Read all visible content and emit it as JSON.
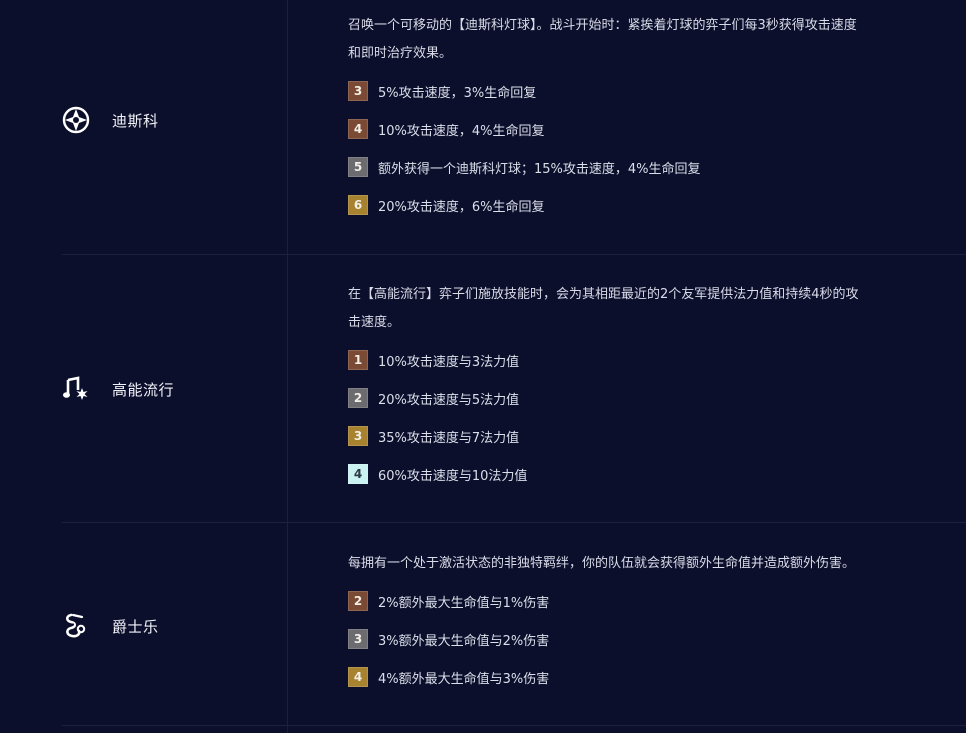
{
  "traits": [
    {
      "name": "迪斯科",
      "icon": "disco-ball-icon",
      "description_line1": "召唤一个可移动的【迪斯科灯球】。战斗开始时：紧挨着灯球的弈子们每3秒获得攻击速度",
      "description_line2": "和即时治疗效果。",
      "tiers": [
        {
          "count": "3",
          "text": "5%攻击速度，3%生命回复",
          "tier": "bronze"
        },
        {
          "count": "4",
          "text": "10%攻击速度，4%生命回复",
          "tier": "bronze"
        },
        {
          "count": "5",
          "text": "额外获得一个迪斯科灯球；15%攻击速度，4%生命回复",
          "tier": "silver"
        },
        {
          "count": "6",
          "text": "20%攻击速度，6%生命回复",
          "tier": "gold"
        }
      ]
    },
    {
      "name": "高能流行",
      "icon": "music-note-spark-icon",
      "description_line1": "在【高能流行】弈子们施放技能时，会为其相距最近的2个友军提供法力值和持续4秒的攻",
      "description_line2": "击速度。",
      "tiers": [
        {
          "count": "1",
          "text": "10%攻击速度与3法力值",
          "tier": "bronze"
        },
        {
          "count": "2",
          "text": "20%攻击速度与5法力值",
          "tier": "silver"
        },
        {
          "count": "3",
          "text": "35%攻击速度与7法力值",
          "tier": "gold"
        },
        {
          "count": "4",
          "text": "60%攻击速度与10法力值",
          "tier": "prismatic"
        }
      ]
    },
    {
      "name": "爵士乐",
      "icon": "saxophone-icon",
      "description_line1": "每拥有一个处于激活状态的非独特羁绊，你的队伍就会获得额外生命值并造成额外伤害。",
      "tiers": [
        {
          "count": "2",
          "text": "2%额外最大生命值与1%伤害",
          "tier": "bronze"
        },
        {
          "count": "3",
          "text": "3%额外最大生命值与2%伤害",
          "tier": "silver"
        },
        {
          "count": "4",
          "text": "4%额外最大生命值与3%伤害",
          "tier": "gold"
        }
      ]
    }
  ]
}
